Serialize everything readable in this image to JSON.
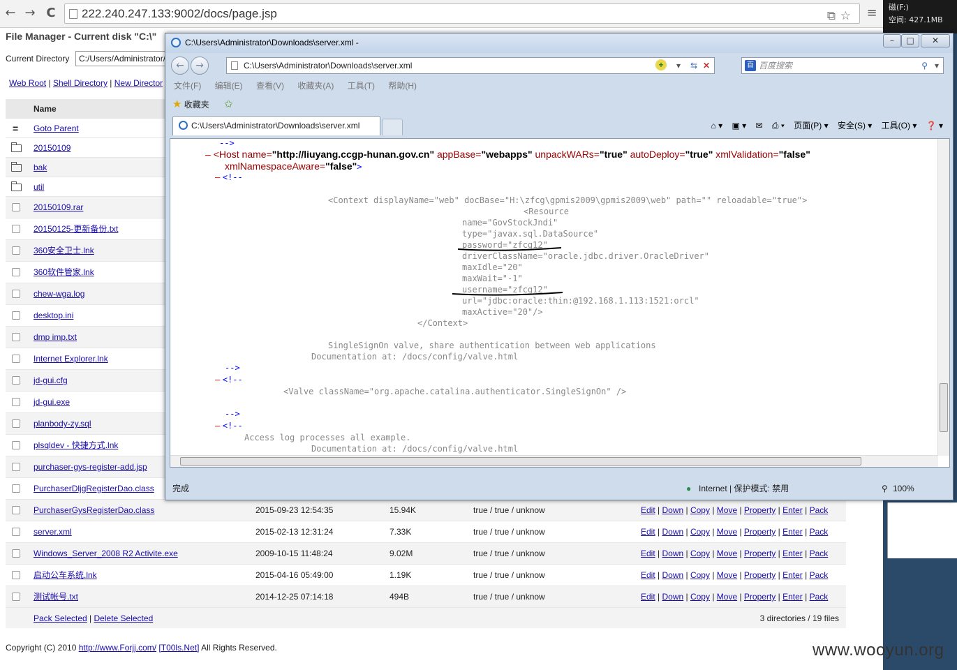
{
  "browser": {
    "url": "222.240.247.133:9002/docs/page.jsp",
    "back_icon": "←",
    "forward_icon": "→",
    "reload_icon": "C",
    "menu_icon": "≡"
  },
  "side": {
    "line1": "磁(F:)",
    "line2": "空间: 427.1MB"
  },
  "fm": {
    "title": "File Manager - Current disk \"C:\\\"",
    "curdir_label": "Current Directory",
    "curdir_value": "C:/Users/Administrator/",
    "links": [
      "Web Root",
      "Shell Directory",
      "New Director"
    ],
    "col_name": "Name",
    "goto_parent": "Goto Parent",
    "folders": [
      "20150109",
      "bak",
      "util"
    ],
    "files": [
      {
        "name": "20150109.rar"
      },
      {
        "name": "20150125-更新备份.txt"
      },
      {
        "name": "360安全卫士.lnk"
      },
      {
        "name": "360软件管家.lnk"
      },
      {
        "name": "chew-wga.log"
      },
      {
        "name": "desktop.ini"
      },
      {
        "name": "dmp imp.txt"
      },
      {
        "name": "Internet Explorer.lnk"
      },
      {
        "name": "jd-gui.cfg"
      },
      {
        "name": "jd-gui.exe"
      },
      {
        "name": "planbody-zy.sql"
      },
      {
        "name": "plsqldev - 快捷方式.lnk"
      },
      {
        "name": "purchaser-gys-register-add.jsp"
      },
      {
        "name": "PurchaserDljgRegisterDao.class"
      },
      {
        "name": "PurchaserGysRegisterDao.class",
        "date": "2015-09-23 12:54:35",
        "size": "15.94K",
        "attr": "true / true / unknow"
      },
      {
        "name": "server.xml",
        "date": "2015-02-13 12:31:24",
        "size": "7.33K",
        "attr": "true / true / unknow"
      },
      {
        "name": "Windows_Server_2008 R2 Activite.exe",
        "date": "2009-10-15 11:48:24",
        "size": "9.02M",
        "attr": "true / true / unknow"
      },
      {
        "name": "启动公车系统.lnk",
        "date": "2015-04-16 05:49:00",
        "size": "1.19K",
        "attr": "true / true / unknow"
      },
      {
        "name": "测试帐号.txt",
        "date": "2014-12-25 07:14:18",
        "size": "494B",
        "attr": "true / true / unknow"
      }
    ],
    "actions": [
      "Edit",
      "Down",
      "Copy",
      "Move",
      "Property",
      "Enter",
      "Pack"
    ],
    "pack_selected": "Pack Selected",
    "delete_selected": "Delete Selected",
    "summary": "3 directories / 19 files",
    "copyright_pre": "Copyright (C) 2010 ",
    "copyright_link1": "http://www.Forjj.com/",
    "copyright_link2": "[T00ls.Net]",
    "copyright_post": " All Rights Reserved."
  },
  "ie": {
    "title": "C:\\Users\\Administrator\\Downloads\\server.xml -",
    "address": "C:\\Users\\Administrator\\Downloads\\server.xml",
    "search_placeholder": "百度搜索",
    "menu": [
      "文件(F)",
      "编辑(E)",
      "查看(V)",
      "收藏夹(A)",
      "工具(T)",
      "帮助(H)"
    ],
    "favorites": "收藏夹",
    "tab": "C:\\Users\\Administrator\\Downloads\\server.xml",
    "cmd": [
      "页面(P) ▾",
      "安全(S) ▾",
      "工具(O) ▾"
    ],
    "status_left": "完成",
    "status_zone": "Internet | 保护模式: 禁用",
    "zoom": "100%"
  },
  "xml": {
    "l1": "-->",
    "host_tag": "<Host",
    "host_a1": " name=",
    "host_v1": "\"http://liuyang.ccgp-hunan.gov.cn\"",
    "host_a2": " appBase=",
    "host_v2": "\"webapps\"",
    "host_a3": " unpackWARs=",
    "host_v3": "\"true\"",
    "host_a4": " autoDeploy=",
    "host_v4": "\"true\"",
    "host_a5": " xmlValidation=",
    "host_v5": "\"false\"",
    "host_a6": "xmlNamespaceAware=",
    "host_v6": "\"false\"",
    "host_end": ">",
    "open_cmt": "<!--",
    "c1": "<Context displayName=\"web\" docBase=\"H:\\zfcg\\gpmis2009\\gpmis2009\\web\" path=\"\" reloadable=\"true\">",
    "c2": "<Resource",
    "c3": "name=\"GovStockJndi\"",
    "c4": "type=\"javax.sql.DataSource\"",
    "c5": "password=\"zfcg12\"",
    "c6": "driverClassName=\"oracle.jdbc.driver.OracleDriver\"",
    "c7": "maxIdle=\"20\"",
    "c8": "maxWait=\"-1\"",
    "c9": "username=\"zfcg12\"",
    "c10": "url=\"jdbc:oracle:thin:@192.168.1.113:1521:orcl\"",
    "c11": "maxActive=\"20\"/>",
    "c12": "</Context>",
    "c13": "SingleSignOn valve, share authentication between web applications",
    "c14": "Documentation at: /docs/config/valve.html",
    "close_cmt": "-->",
    "c15": "<Valve className=\"org.apache.catalina.authenticator.SingleSignOn\" />",
    "c16": "Access log processes all example.",
    "c17": "Documentation at: /docs/config/valve.html"
  },
  "watermark": "www.wooyun.org"
}
